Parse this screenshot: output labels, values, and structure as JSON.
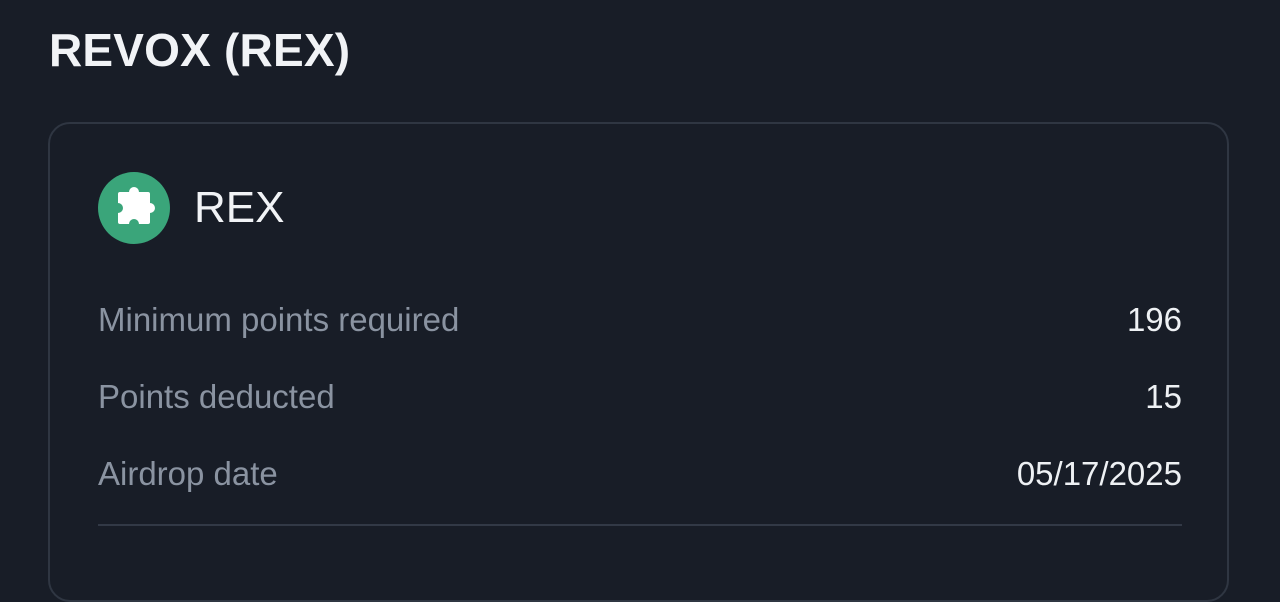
{
  "page": {
    "title": "REVOX (REX)"
  },
  "token": {
    "symbol": "REX",
    "icon": "puzzle-piece-icon",
    "icon_bg": "#3aa57a"
  },
  "details": [
    {
      "label": "Minimum points required",
      "value": "196"
    },
    {
      "label": "Points deducted",
      "value": "15"
    },
    {
      "label": "Airdrop date",
      "value": "05/17/2025"
    }
  ]
}
